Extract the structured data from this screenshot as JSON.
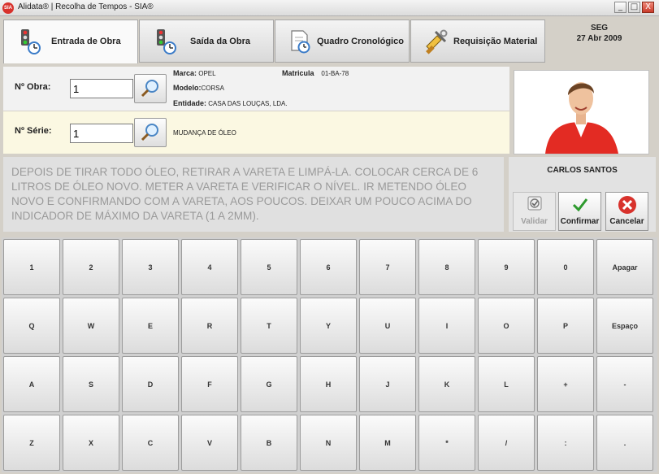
{
  "window": {
    "title": "Alidata® | Recolha de Tempos - SIA®",
    "app_icon_text": "SIA",
    "minimize": "_",
    "maximize": "□",
    "close": "X"
  },
  "tabs": [
    {
      "label": "Entrada de Obra",
      "icon": "traffic-light-clock-icon"
    },
    {
      "label": "Saída da Obra",
      "icon": "traffic-light-clock-icon"
    },
    {
      "label": "Quadro Cronológico",
      "icon": "document-clock-icon"
    },
    {
      "label": "Requisição Material",
      "icon": "tools-icon"
    }
  ],
  "date": {
    "weekday": "SEG",
    "date": "27 Abr 2009"
  },
  "obra": {
    "label": "Nº Obra:",
    "value": "1",
    "marca_label": "Marca:",
    "marca": "OPEL",
    "matricula_label": "Matricula",
    "matricula": "01-BA-78",
    "modelo_label": "Modelo:",
    "modelo": "CORSA",
    "entidade_label": "Entidade:",
    "entidade": "CASA DAS LOUÇAS, LDA."
  },
  "serie": {
    "label": "Nº Série:",
    "value": "1",
    "description": "MUDANÇA DE ÓLEO"
  },
  "instructions": "DEPOIS DE TIRAR TODO ÓLEO, RETIRAR A VARETA E LIMPÁ-LA. COLOCAR CERCA DE 6 LITROS DE ÓLEO NOVO. METER A VARETA E VERIFICAR O NÍVEL. IR METENDO ÓLEO NOVO E CONFIRMANDO COM A VARETA, AOS POUCOS. DEIXAR UM POUCO ACIMA DO INDICADOR DE MÁXIMO DA VARETA (1 A 2MM).",
  "employee": {
    "name": "CARLOS SANTOS"
  },
  "actions": {
    "validar": "Validar",
    "confirmar": "Confirmar",
    "cancelar": "Cancelar"
  },
  "keyboard": {
    "rows": [
      [
        "1",
        "2",
        "3",
        "4",
        "5",
        "6",
        "7",
        "8",
        "9",
        "0",
        "Apagar"
      ],
      [
        "Q",
        "W",
        "E",
        "R",
        "T",
        "Y",
        "U",
        "I",
        "O",
        "P",
        "Espaço"
      ],
      [
        "A",
        "S",
        "D",
        "F",
        "G",
        "H",
        "J",
        "K",
        "L",
        "+",
        "-"
      ],
      [
        "Z",
        "X",
        "C",
        "V",
        "B",
        "N",
        "M",
        "*",
        "/",
        ":",
        "."
      ]
    ]
  },
  "colors": {
    "confirm_green": "#2e9a2e",
    "cancel_red": "#d8322c",
    "info_row_bg": "#fbf8e2"
  }
}
